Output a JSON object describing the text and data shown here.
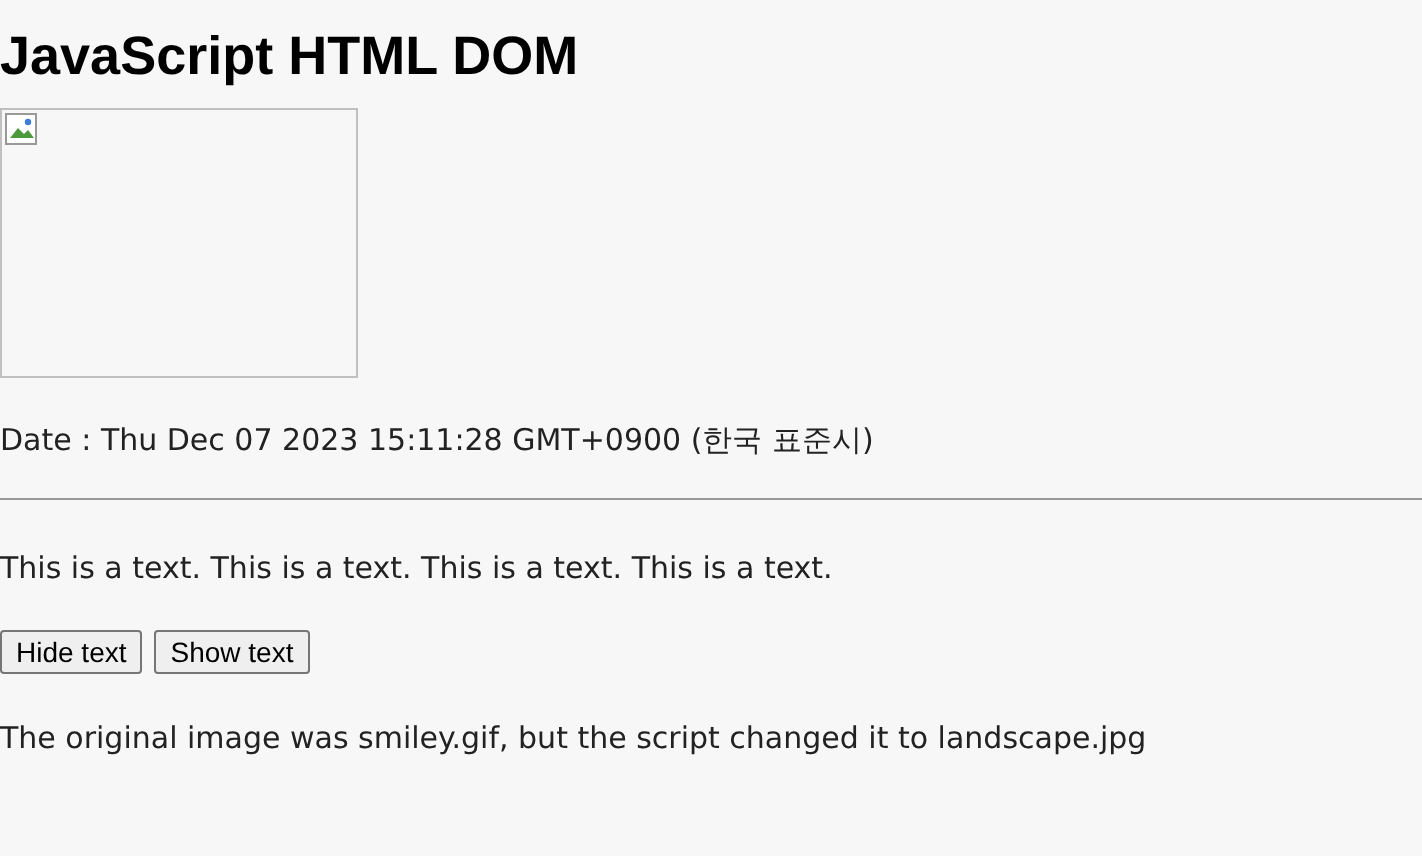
{
  "heading": "JavaScript HTML DOM",
  "date_line": "Date : Thu Dec 07 2023 15:11:28 GMT+0900 (한국 표준시)",
  "text_line": "This is a text. This is a text. This is a text. This is a text.",
  "buttons": [
    {
      "label": "Hide text"
    },
    {
      "label": "Show text"
    }
  ],
  "note": "The original image was smiley.gif, but the script changed it to landscape.jpg"
}
